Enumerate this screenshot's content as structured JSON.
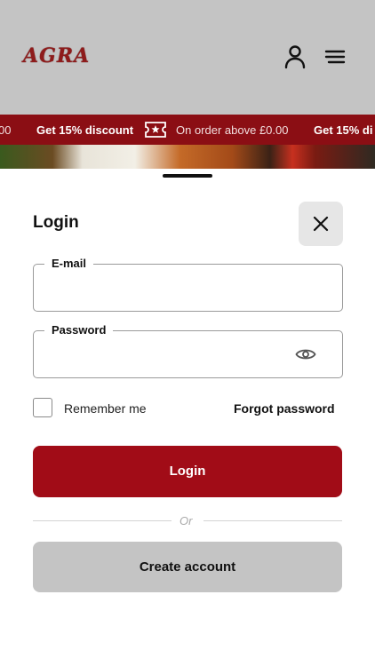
{
  "header": {
    "logo_text": "AGRA",
    "brand_color": "#8e1b1b",
    "background": "#c4c4c4",
    "icons": [
      "user-icon",
      "hamburger-menu-icon"
    ]
  },
  "ticker": {
    "background": "#8b0e14",
    "items": [
      {
        "text": "00",
        "style": "light"
      },
      {
        "text": "Get 15% discount",
        "style": "bold"
      },
      {
        "text": "On order above £0.00",
        "style": "light"
      },
      {
        "text": "Get 15% di",
        "style": "bold"
      }
    ],
    "icon": "ticket-icon"
  },
  "login_sheet": {
    "title": "Login",
    "close_icon": "close-icon",
    "email": {
      "label": "E-mail",
      "value": "",
      "placeholder": ""
    },
    "password": {
      "label": "Password",
      "value": "",
      "placeholder": "",
      "toggle_icon": "eye-icon"
    },
    "remember_label": "Remember me",
    "remember_checked": false,
    "forgot_label": "Forgot password",
    "login_label": "Login",
    "login_color": "#a10c17",
    "divider_text": "Or",
    "create_label": "Create account",
    "create_color": "#c4c4c4"
  }
}
